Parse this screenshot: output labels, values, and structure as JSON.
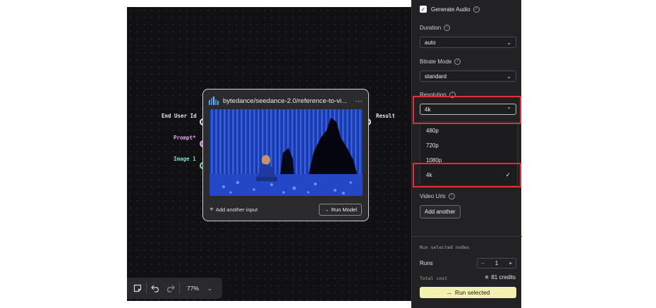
{
  "node": {
    "title": "bytedance/seedance-2.0/reference-to-vi...",
    "more_icon": "⋯",
    "add_input_label": "Add another input",
    "run_model_label": "Run Model",
    "inputs": [
      {
        "label": "End User Id",
        "color": "#e6e6e6"
      },
      {
        "label": "Prompt*",
        "color": "#e79bf0"
      },
      {
        "label": "Image 1",
        "color": "#7fe0b8"
      }
    ],
    "output_label": "Result"
  },
  "toolbar": {
    "zoom": "77%"
  },
  "panel": {
    "generate_audio_label": "Generate Audio",
    "generate_audio_checked": true,
    "duration": {
      "label": "Duration",
      "value": "auto"
    },
    "bitrate": {
      "label": "Bitrate Mode",
      "value": "standard"
    },
    "resolution": {
      "label": "Resolution",
      "value": "4k",
      "options": [
        "480p",
        "720p",
        "1080p",
        "4k"
      ],
      "selected": "4k"
    },
    "video_urls": {
      "label": "Video Urls",
      "add_label": "Add another"
    },
    "run_section_label": "Run selected nodes",
    "runs_label": "Runs",
    "runs_value": "1",
    "total_cost_label": "Total cost",
    "total_cost_value": "81 credits",
    "run_selected_label": "Run selected"
  },
  "colors": {
    "highlight": "#e0303a",
    "accent_button": "#f3f1b0"
  }
}
